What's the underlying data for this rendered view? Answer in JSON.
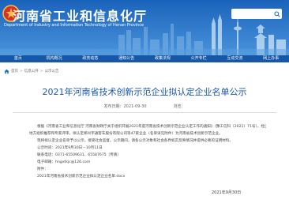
{
  "header": {
    "title": "河南省工业和信息化厅",
    "subtitle": "Department of Industry and Information Technology of Henan Province",
    "search": {
      "placeholder": ""
    }
  },
  "nav": {
    "items": [
      "首页",
      "机构概况",
      "政务动态",
      "通知公告",
      "政策法规",
      "公开专栏",
      "互动交流",
      "网上办事"
    ]
  },
  "breadcrumb": {
    "items": [
      "首页",
      "信息公开",
      "公示公告"
    ],
    "separator": ">"
  },
  "article": {
    "title": "2021年河南省技术创新示范企业拟认定企业名单公示",
    "date_label": "发布日期：2021-09-30",
    "views_label": "浏览：",
    "paragraphs": [
      "根据《河南省工业和信息化厅 河南省财政厅关于组织开展2021年度河南省技术创新示范企业认定工作的通知》（豫工信科〔2021〕71号），经企业自主申报、",
      "地方组织推荐和专家评审，拟认定郑州宇通客车股份有限公司等47家企业（名单详见附件）为河南省技术创新示范企业。",
      "现将拟认定企业名单予以公示，接受社会监督。公示期间，请各公示对象和社会各界如实反映情况并提供必要的证明材料。",
      "公示时间：2021年9月30日—10月11日",
      "联系电话：0371-65509631、65587675（传真）",
      "电子邮箱：hngxtkjc@126.com",
      "附件：",
      "2021年河南省技术创新示范企业拟认定企业名单.docx"
    ],
    "sign_date": "2021年9月30日"
  },
  "colors": {
    "banner": "#1f6fc7",
    "nav": "#1757a8",
    "title": "#1a57a8"
  },
  "icons": {
    "emblem": "emblem-icon",
    "search": "search-icon",
    "home": "home-icon"
  }
}
